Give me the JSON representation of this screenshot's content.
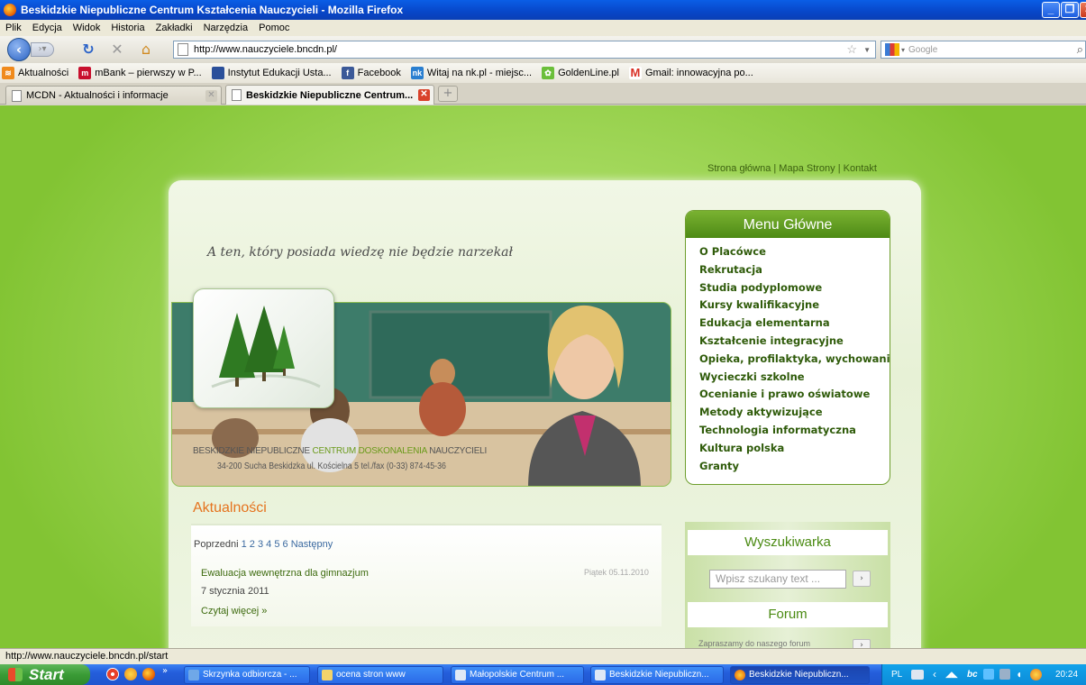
{
  "window": {
    "title": "Beskidzkie Niepubliczne Centrum Kształcenia Nauczycieli - Mozilla Firefox"
  },
  "menubar": [
    "Plik",
    "Edycja",
    "Widok",
    "Historia",
    "Zakładki",
    "Narzędzia",
    "Pomoc"
  ],
  "nav": {
    "url": "http://www.nauczyciele.bncdn.pl/",
    "search_placeholder": "Google"
  },
  "bookmarks": [
    {
      "label": "Aktualności",
      "icon": "rss-icon",
      "color": "#f08a1c"
    },
    {
      "label": "mBank – pierwszy w P...",
      "icon": "mbank-icon",
      "color": "#c8102e"
    },
    {
      "label": "Instytut Edukacji Usta...",
      "icon": "page-icon",
      "color": "#2a4f9a"
    },
    {
      "label": "Facebook",
      "icon": "facebook-icon",
      "color": "#3b5998"
    },
    {
      "label": "Witaj na nk.pl - miejsc...",
      "icon": "nk-icon",
      "color": "#2a7fd0"
    },
    {
      "label": "GoldenLine.pl",
      "icon": "goldenline-icon",
      "color": "#6bbf3a"
    },
    {
      "label": "Gmail: innowacyjna po...",
      "icon": "gmail-icon",
      "color": "#d93025"
    }
  ],
  "tabs": [
    {
      "label": "MCDN - Aktualności i informacje",
      "active": false
    },
    {
      "label": "Beskidzkie Niepubliczne Centrum...",
      "active": true
    }
  ],
  "page": {
    "top_links": "Strona główna | Mapa Strony | Kontakt",
    "motto": "A ten, który posiada wiedzę nie będzie narzekał",
    "org_name_start": "BESKIDZKIE NIEPUBLICZNE ",
    "org_name_highlight": "CENTRUM DOSKONALENIA",
    "org_name_end": " NAUCZYCIELI",
    "org_address": "34-200 Sucha Beskidzka  ul. Kościelna 5  tel./fax (0-33) 874-45-36",
    "menu": {
      "title": "Menu Główne",
      "items": [
        "O Placówce",
        "Rekrutacja",
        "Studia podyplomowe",
        "Kursy kwalifikacyjne",
        "Edukacja elementarna",
        "Kształcenie integracyjne",
        "Opieka, profilaktyka, wychowanie",
        "Wycieczki szkolne",
        "Ocenianie i prawo oświatowe",
        "Metody aktywizujące",
        "Technologia informatyczna",
        "Kultura polska",
        "Granty"
      ]
    },
    "news": {
      "title": "Aktualności",
      "pager_prev": "Poprzedni",
      "pages": [
        "1",
        "2",
        "3",
        "4",
        "5",
        "6"
      ],
      "pager_next": "Następny",
      "item_title": "Ewaluacja wewnętrzna dla gimnazjum",
      "item_date": "Piątek 05.11.2010",
      "item_published": "7 stycznia 2011",
      "item_more": "Czytaj więcej »"
    },
    "search": {
      "title": "Wyszukiwarka",
      "placeholder": "Wpisz szukany text ..."
    },
    "forum": {
      "title": "Forum",
      "message": "Zapraszamy do naszego forum"
    }
  },
  "status": {
    "text": "http://www.nauczyciele.bncdn.pl/start"
  },
  "taskbar": {
    "start": "Start",
    "buttons": [
      {
        "label": "Skrzynka odbiorcza - ...",
        "active": false
      },
      {
        "label": "ocena stron www",
        "active": false
      },
      {
        "label": "Małopolskie Centrum ...",
        "active": false
      },
      {
        "label": "Beskidzkie Niepubliczn...",
        "active": false
      },
      {
        "label": "Beskidzkie Niepubliczn...",
        "active": true
      }
    ],
    "lang": "PL",
    "clock": "20:24"
  }
}
